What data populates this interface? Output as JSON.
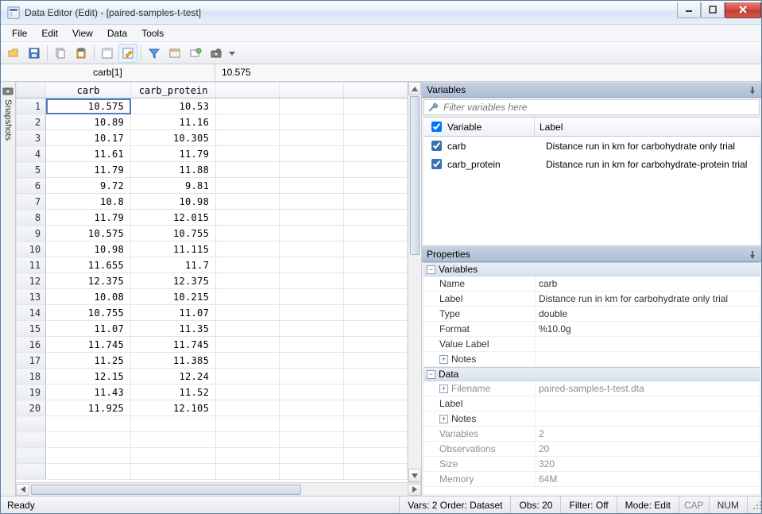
{
  "window": {
    "title": "Data Editor (Edit) - [paired-samples-t-test]"
  },
  "menu": {
    "file": "File",
    "edit": "Edit",
    "view": "View",
    "data": "Data",
    "tools": "Tools"
  },
  "address": {
    "cell": "carb[1]",
    "value": "10.575"
  },
  "snapshots_label": "Snapshots",
  "grid": {
    "columns": [
      "carb",
      "carb_protein"
    ],
    "rows": [
      {
        "n": 1,
        "carb": "10.575",
        "carb_protein": "10.53"
      },
      {
        "n": 2,
        "carb": "10.89",
        "carb_protein": "11.16"
      },
      {
        "n": 3,
        "carb": "10.17",
        "carb_protein": "10.305"
      },
      {
        "n": 4,
        "carb": "11.61",
        "carb_protein": "11.79"
      },
      {
        "n": 5,
        "carb": "11.79",
        "carb_protein": "11.88"
      },
      {
        "n": 6,
        "carb": "9.72",
        "carb_protein": "9.81"
      },
      {
        "n": 7,
        "carb": "10.8",
        "carb_protein": "10.98"
      },
      {
        "n": 8,
        "carb": "11.79",
        "carb_protein": "12.015"
      },
      {
        "n": 9,
        "carb": "10.575",
        "carb_protein": "10.755"
      },
      {
        "n": 10,
        "carb": "10.98",
        "carb_protein": "11.115"
      },
      {
        "n": 11,
        "carb": "11.655",
        "carb_protein": "11.7"
      },
      {
        "n": 12,
        "carb": "12.375",
        "carb_protein": "12.375"
      },
      {
        "n": 13,
        "carb": "10.08",
        "carb_protein": "10.215"
      },
      {
        "n": 14,
        "carb": "10.755",
        "carb_protein": "11.07"
      },
      {
        "n": 15,
        "carb": "11.07",
        "carb_protein": "11.35"
      },
      {
        "n": 16,
        "carb": "11.745",
        "carb_protein": "11.745"
      },
      {
        "n": 17,
        "carb": "11.25",
        "carb_protein": "11.385"
      },
      {
        "n": 18,
        "carb": "12.15",
        "carb_protein": "12.24"
      },
      {
        "n": 19,
        "carb": "11.43",
        "carb_protein": "11.52"
      },
      {
        "n": 20,
        "carb": "11.925",
        "carb_protein": "12.105"
      }
    ],
    "blank_rows": 4
  },
  "variables_panel": {
    "title": "Variables",
    "filter_placeholder": "Filter variables here",
    "header": {
      "variable": "Variable",
      "label": "Label"
    },
    "rows": [
      {
        "name": "carb",
        "label": "Distance run in km for carbohydrate only trial"
      },
      {
        "name": "carb_protein",
        "label": "Distance run in km for carbohydrate-protein trial"
      }
    ]
  },
  "properties_panel": {
    "title": "Properties",
    "groups": {
      "variables": {
        "title": "Variables",
        "name_k": "Name",
        "name_v": "carb",
        "label_k": "Label",
        "label_v": "Distance run in km for carbohydrate only trial",
        "type_k": "Type",
        "type_v": "double",
        "format_k": "Format",
        "format_v": "%10.0g",
        "valuelabel_k": "Value Label",
        "valuelabel_v": "",
        "notes_k": "Notes"
      },
      "data": {
        "title": "Data",
        "filename_k": "Filename",
        "filename_v": "paired-samples-t-test.dta",
        "label_k": "Label",
        "label_v": "",
        "notes_k": "Notes",
        "variables_k": "Variables",
        "variables_v": "2",
        "observations_k": "Observations",
        "observations_v": "20",
        "size_k": "Size",
        "size_v": "320",
        "memory_k": "Memory",
        "memory_v": "64M"
      }
    }
  },
  "status": {
    "ready": "Ready",
    "vars": "Vars: 2  Order: Dataset",
    "obs": "Obs: 20",
    "filter": "Filter: Off",
    "mode": "Mode: Edit",
    "cap": "CAP",
    "num": "NUM"
  }
}
